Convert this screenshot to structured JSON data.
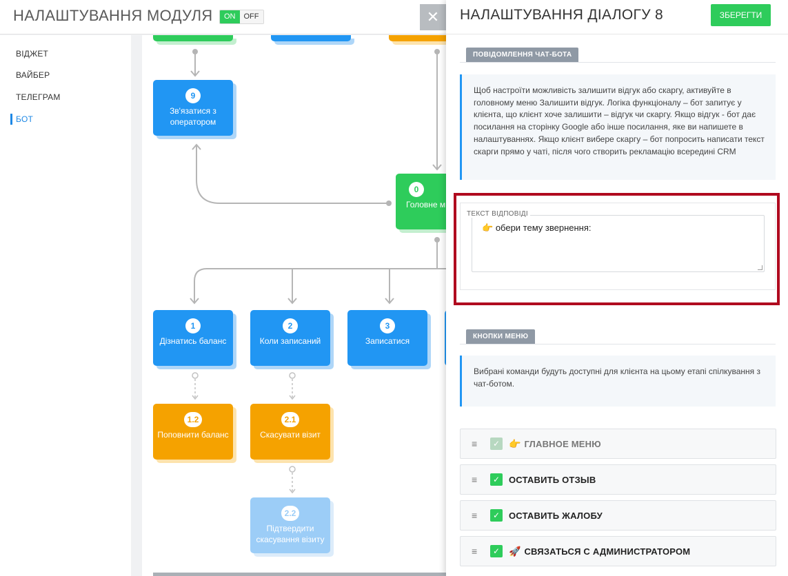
{
  "header": {
    "title": "НАЛАШТУВАННЯ МОДУЛЯ",
    "toggle_on": "ON",
    "toggle_off": "OFF",
    "close_glyph": "✕"
  },
  "nav": {
    "items": [
      {
        "label": "ВІДЖЕТ"
      },
      {
        "label": "ВАЙБЕР"
      },
      {
        "label": "ТЕЛЕГРАМ"
      },
      {
        "label": "БОТ"
      }
    ],
    "active": "БОТ"
  },
  "flow": {
    "nodes": [
      {
        "id": "9",
        "label": "Зв'язатися з оператором",
        "color": "blue"
      },
      {
        "id": "0",
        "label": "Головне м",
        "color": "green"
      },
      {
        "id": "1",
        "label": "Дізнатись баланс",
        "color": "blue"
      },
      {
        "id": "2",
        "label": "Коли записаний",
        "color": "blue"
      },
      {
        "id": "3",
        "label": "Записатися",
        "color": "blue"
      },
      {
        "id": "1.2",
        "label": "Поповнити баланс",
        "color": "orange"
      },
      {
        "id": "2.1",
        "label": "Скасувати візит",
        "color": "orange"
      },
      {
        "id": "2.2",
        "label": "Підтвердити скасування візиту",
        "color": "pale"
      }
    ]
  },
  "panel": {
    "title": "НАЛАШТУВАННЯ ДІАЛОГУ 8",
    "save_label": "ЗБЕРЕГТИ",
    "chat_section_tab": "ПОВІДОМЛЕННЯ ЧАТ-БОТА",
    "chat_info": "Щоб настроїти можливість залишити відгук або скаргу, активуйте в головному меню Залишити відгук. Логіка функціоналу – бот запитує у клієнта, що клієнт хоче залишити – відгук чи скаргу. Якщо відгук - бот дає посилання на сторінку Google або інше посилання, яке ви напишете в налаштуваннях. Якщо клієнт вибере скаргу – бот попросить написати текст скарги прямо у чаті, після чого створить рекламацію всередині CRM",
    "response_legend": "ТЕКСТ ВІДПОВІДІ",
    "response_emoji": "👉",
    "response_text": "обери тему звернення:",
    "menu_section_tab": "КНОПКИ МЕНЮ",
    "menu_info": "Вибрані команди будуть доступні для клієнта на цьому етапі спілкування з чат-ботом.",
    "menu_buttons": [
      {
        "emoji": "👉",
        "label": "ГЛАВНОЕ МЕНЮ",
        "checked": true,
        "disabled": true
      },
      {
        "emoji": "",
        "label": "ОСТАВИТЬ ОТЗЫВ",
        "checked": true,
        "disabled": false
      },
      {
        "emoji": "",
        "label": "ОСТАВИТЬ ЖАЛОБУ",
        "checked": true,
        "disabled": false
      },
      {
        "emoji": "🚀",
        "label": "СВЯЗАТЬСЯ С АДМИНИСТРАТОРОМ",
        "checked": true,
        "disabled": false
      }
    ]
  },
  "colors": {
    "accent_blue": "#2196f3",
    "green": "#2ecc5b",
    "orange": "#f5a200",
    "highlight_red": "#b00a1f"
  }
}
